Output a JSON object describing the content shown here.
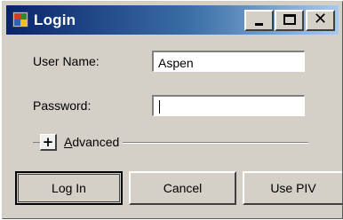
{
  "window": {
    "title": "Login",
    "controls": {
      "minimize": "minimize",
      "maximize": "maximize",
      "close": "close"
    }
  },
  "form": {
    "username_label": "User Name:",
    "username_value": "Aspen",
    "password_label": "Password:",
    "password_value": ""
  },
  "advanced": {
    "toggle_symbol": "+",
    "label_first": "A",
    "label_rest": "dvanced"
  },
  "buttons": {
    "login": "Log In",
    "cancel": "Cancel",
    "use_piv": "Use PIV"
  },
  "colors": {
    "titlebar_start": "#0a246a",
    "titlebar_end": "#a6caf0",
    "dialog_face": "#d4d0c8"
  },
  "icons": {
    "app": "app-window-icon",
    "minimize": "minimize-icon",
    "maximize": "maximize-icon",
    "close": "close-icon"
  }
}
